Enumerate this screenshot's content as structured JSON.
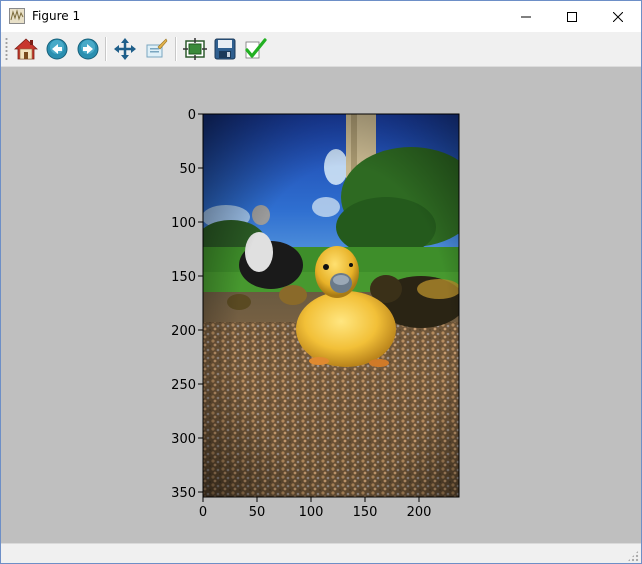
{
  "window": {
    "title": "Figure 1"
  },
  "toolbar": {
    "buttons": [
      {
        "name": "home-icon"
      },
      {
        "name": "back-icon"
      },
      {
        "name": "forward-icon"
      },
      {
        "name": "pan-icon"
      },
      {
        "name": "zoom-icon"
      },
      {
        "name": "configure-subplots-icon"
      },
      {
        "name": "save-icon"
      },
      {
        "name": "edit-parameters-icon"
      }
    ]
  },
  "chart_data": {
    "type": "image",
    "image_description_subject": "",
    "x_ticks": [
      "0",
      "50",
      "100",
      "150",
      "200"
    ],
    "y_ticks": [
      "0",
      "50",
      "100",
      "150",
      "200",
      "250",
      "300",
      "350"
    ],
    "xlim": [
      0,
      237
    ],
    "ylim": [
      355,
      0
    ]
  },
  "colors": {
    "canvas_bg": "#bfbfbf",
    "window_border": "#6d8fc7"
  }
}
